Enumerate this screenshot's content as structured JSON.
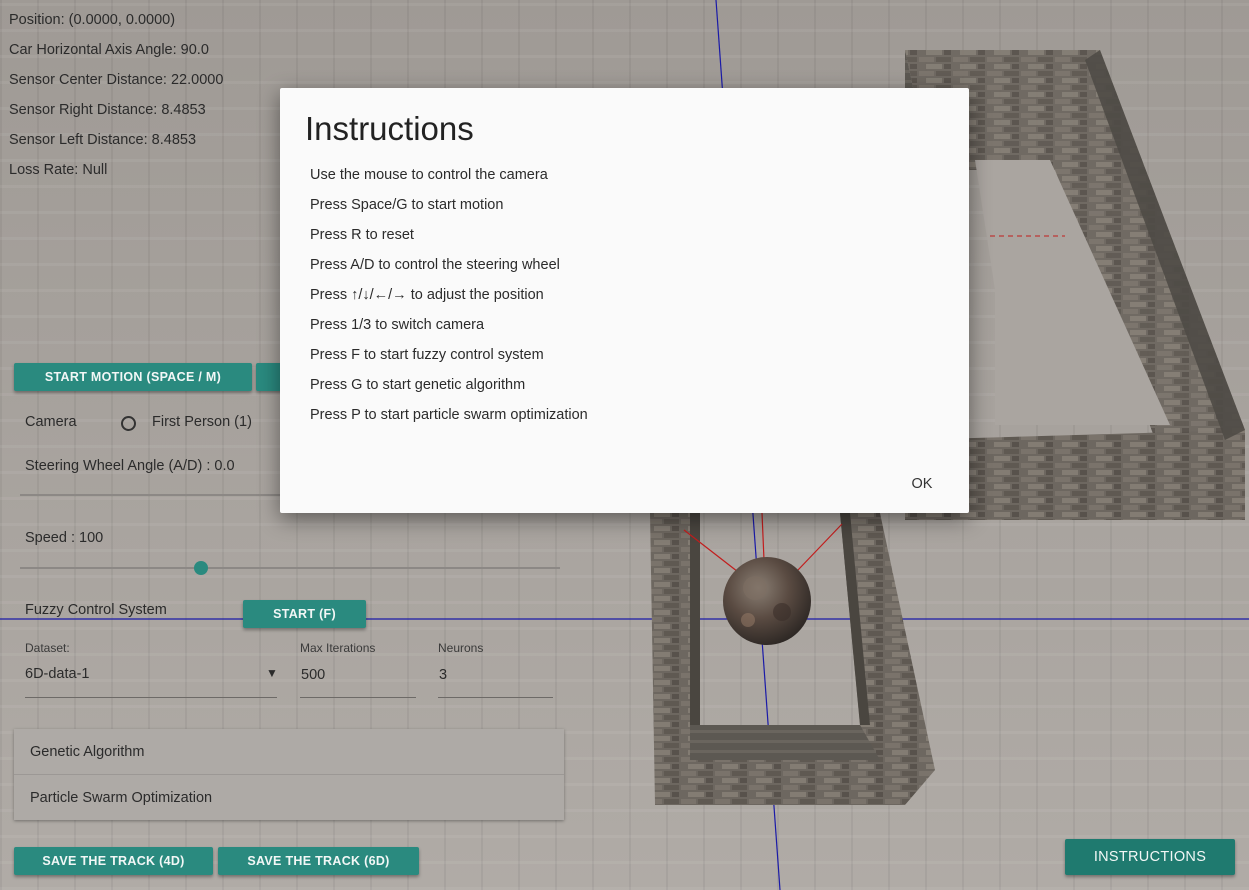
{
  "info": {
    "position": "Position: (0.0000, 0.0000)",
    "car_angle": "Car Horizontal Axis Angle: 90.0",
    "sensor_center": "Sensor Center Distance: 22.0000",
    "sensor_right": "Sensor Right Distance: 8.4853",
    "sensor_left": "Sensor Left Distance: 8.4853",
    "loss_rate": "Loss Rate: Null"
  },
  "controls": {
    "start_motion_label": "START MOTION (SPACE / M)",
    "camera_label": "Camera",
    "camera_option_first_person": "First Person (1)",
    "steering_label": "Steering Wheel Angle (A/D) : 0.0",
    "speed_label": "Speed : 100",
    "speed_value": 100,
    "fuzzy_label": "Fuzzy Control System",
    "fuzzy_start_label": "START (F)",
    "dataset_label": "Dataset:",
    "dataset_value": "6D-data-1",
    "max_iterations_label": "Max Iterations",
    "max_iterations_value": "500",
    "neurons_label": "Neurons",
    "neurons_value": "3",
    "panel_genetic": "Genetic Algorithm",
    "panel_pso": "Particle Swarm Optimization",
    "save_4d_label": "SAVE THE TRACK (4D)",
    "save_6d_label": "SAVE THE TRACK (6D)",
    "instructions_label": "INSTRUCTIONS"
  },
  "modal": {
    "title": "Instructions",
    "lines": [
      "Use the mouse to control the camera",
      "Press Space/G to start motion",
      "Press R to reset",
      "Press A/D to control the steering wheel",
      "Press ↑/↓/←/→ to adjust the position",
      "Press 1/3 to switch camera",
      "Press F to start fuzzy control system",
      "Press G to start genetic algorithm",
      "Press P to start particle swarm optimization"
    ],
    "ok_label": "OK"
  },
  "colors": {
    "accent": "#2a8a7f",
    "axis_blue": "#1a1aa8",
    "sensor_red": "#c21d1d"
  }
}
